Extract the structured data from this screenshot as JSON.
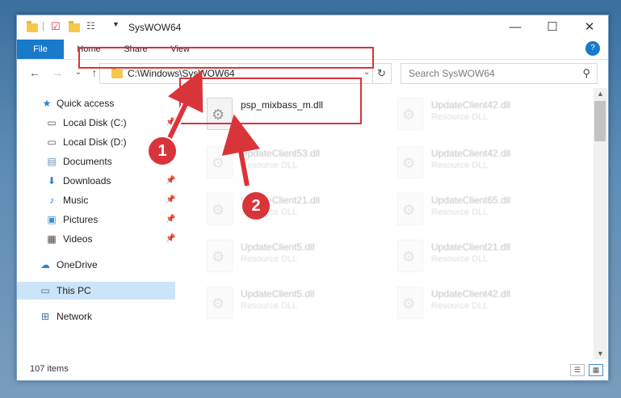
{
  "window": {
    "title": "SysWOW64"
  },
  "window_controls": {
    "minimize": "—",
    "maximize": "☐",
    "close": "✕"
  },
  "ribbon": {
    "tabs": [
      "File",
      "Home",
      "Share",
      "View"
    ],
    "help": "?"
  },
  "address": {
    "path": "C:\\Windows\\SysWOW64",
    "dropdown": "⌄",
    "refresh": "↻"
  },
  "search": {
    "placeholder": "Search SysWOW64",
    "icon": "⚲"
  },
  "nav": {
    "back": "←",
    "forward": "→",
    "recent": "⌄",
    "up": "↑"
  },
  "sidebar": {
    "items": [
      {
        "label": "Quick access",
        "icon": "star-icon"
      },
      {
        "label": "Local Disk (C:)",
        "icon": "drive-icon"
      },
      {
        "label": "Local Disk (D:)",
        "icon": "drive-icon"
      },
      {
        "label": "Documents",
        "icon": "documents-icon"
      },
      {
        "label": "Downloads",
        "icon": "downloads-icon"
      },
      {
        "label": "Music",
        "icon": "music-icon"
      },
      {
        "label": "Pictures",
        "icon": "pictures-icon"
      },
      {
        "label": "Videos",
        "icon": "videos-icon"
      },
      {
        "label": "OneDrive",
        "icon": "cloud-icon"
      },
      {
        "label": "This PC",
        "icon": "pc-icon"
      },
      {
        "label": "Network",
        "icon": "network-icon"
      }
    ]
  },
  "files": [
    {
      "name": "psp_mixbass_m.dll",
      "type": ""
    },
    {
      "name": "UpdateClient42.dll",
      "type": "Resource DLL"
    },
    {
      "name": "UpdateClient53.dll",
      "type": "Resource DLL"
    },
    {
      "name": "UpdateClient42.dll",
      "type": "Resource DLL"
    },
    {
      "name": "UpdateClient21.dll",
      "type": "Resource DLL"
    },
    {
      "name": "UpdateClient65.dll",
      "type": "Resource DLL"
    },
    {
      "name": "UpdateClient5.dll",
      "type": "Resource DLL"
    },
    {
      "name": "UpdateClient21.dll",
      "type": "Resource DLL"
    },
    {
      "name": "UpdateClient5.dll",
      "type": "Resource DLL"
    },
    {
      "name": "UpdateClient42.dll",
      "type": "Resource DLL"
    }
  ],
  "status": {
    "item_count": "107 items"
  },
  "callouts": [
    "1",
    "2"
  ],
  "colors": {
    "accent": "#1979ca",
    "highlight": "#d9343a",
    "selected": "#cce4f7"
  }
}
